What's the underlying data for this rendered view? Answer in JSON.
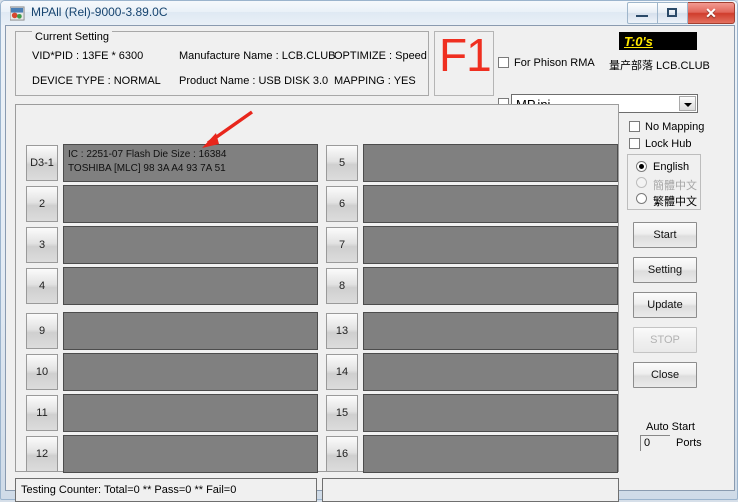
{
  "window": {
    "title": "MPAll (Rel)-9000-3.89.0C",
    "icon": "app-icon",
    "buttons": {
      "minimize": "–",
      "maximize": "□",
      "close": "✕"
    }
  },
  "current_setting": {
    "legend": "Current Setting",
    "fields": [
      {
        "label": "VID*PID : 13FE * 6300"
      },
      {
        "label": "Manufacture Name : LCB.CLUB"
      },
      {
        "label": "OPTIMIZE : Speed"
      },
      {
        "label": "DEVICE TYPE : NORMAL"
      },
      {
        "label": "Product Name : USB DISK 3.0"
      },
      {
        "label": "MAPPING : YES"
      }
    ]
  },
  "f1_badge": {
    "text": "F1",
    "color": "#ef2f20"
  },
  "timer": {
    "text": "T:0's",
    "fg": "#ffe800",
    "bg": "#000000"
  },
  "brand": {
    "text": "量产部落 LCB.CLUB"
  },
  "options": {
    "for_phison_rma": {
      "label": "For Phison RMA",
      "checked": false
    },
    "ini_checkbox": {
      "label": "",
      "checked": false
    },
    "ini_combo": {
      "value": "MP.ini"
    },
    "no_mapping": {
      "label": "No Mapping",
      "checked": false
    },
    "lock_hub": {
      "label": "Lock Hub",
      "checked": false
    }
  },
  "language": {
    "items": [
      {
        "label": "English",
        "selected": true,
        "disabled": false
      },
      {
        "label": "簡體中文",
        "selected": false,
        "disabled": true
      },
      {
        "label": "繁體中文",
        "selected": false,
        "disabled": false
      }
    ]
  },
  "actions": {
    "start": {
      "label": "Start",
      "disabled": false
    },
    "setting": {
      "label": "Setting",
      "disabled": false
    },
    "update": {
      "label": "Update",
      "disabled": false
    },
    "stop": {
      "label": "STOP",
      "disabled": true
    },
    "close": {
      "label": "Close",
      "disabled": false
    }
  },
  "auto_start": {
    "label": "Auto Start",
    "ports_value": "0",
    "ports_label": "Ports"
  },
  "ports": {
    "left": [
      {
        "num": "D3-1",
        "line1": "IC : 2251-07  Flash Die Size : 16384",
        "line2": "TOSHIBA [MLC] 98 3A A4 93 7A 51"
      },
      {
        "num": "2",
        "line1": "",
        "line2": ""
      },
      {
        "num": "3",
        "line1": "",
        "line2": ""
      },
      {
        "num": "4",
        "line1": "",
        "line2": ""
      },
      {
        "num": "9",
        "line1": "",
        "line2": ""
      },
      {
        "num": "10",
        "line1": "",
        "line2": ""
      },
      {
        "num": "11",
        "line1": "",
        "line2": ""
      },
      {
        "num": "12",
        "line1": "",
        "line2": ""
      }
    ],
    "right": [
      {
        "num": "5",
        "line1": "",
        "line2": ""
      },
      {
        "num": "6",
        "line1": "",
        "line2": ""
      },
      {
        "num": "7",
        "line1": "",
        "line2": ""
      },
      {
        "num": "8",
        "line1": "",
        "line2": ""
      },
      {
        "num": "13",
        "line1": "",
        "line2": ""
      },
      {
        "num": "14",
        "line1": "",
        "line2": ""
      },
      {
        "num": "15",
        "line1": "",
        "line2": ""
      },
      {
        "num": "16",
        "line1": "",
        "line2": ""
      }
    ]
  },
  "status": {
    "counter": "Testing Counter: Total=0 ** Pass=0 ** Fail=0",
    "message": ""
  },
  "annotation": {
    "arrow_color": "#e8261c"
  }
}
